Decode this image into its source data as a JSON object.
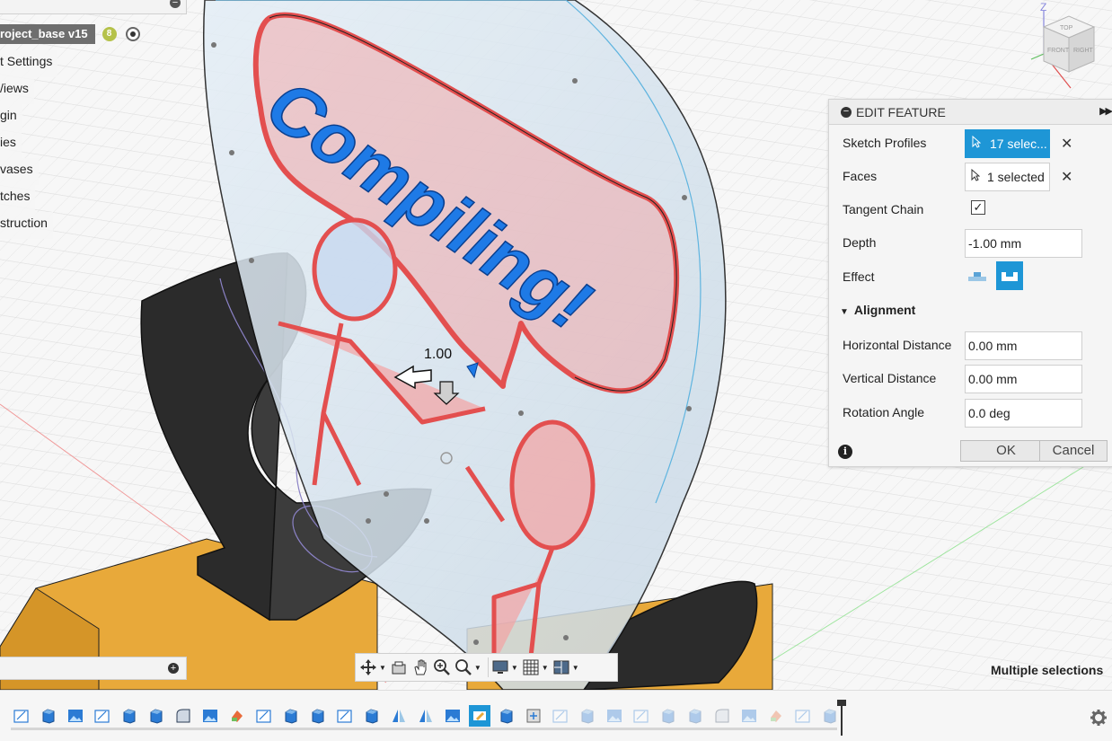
{
  "browser": {
    "document_title": "roject_base v15",
    "badge": "8",
    "items": [
      "t Settings",
      "/iews",
      "gin",
      "ies",
      "vases",
      "tches",
      "struction"
    ]
  },
  "viewport": {
    "sign_text": "Compiling!",
    "dimension_value": "1.00",
    "status": "Multiple selections"
  },
  "viewcube": {
    "axis_z": "Z",
    "face_top": "TOP",
    "face_front": "FRONT",
    "face_right": "RIGHT"
  },
  "edit_feature": {
    "title": "EDIT FEATURE",
    "sketch_profiles_label": "Sketch Profiles",
    "sketch_profiles_value": "17 selec...",
    "faces_label": "Faces",
    "faces_value": "1 selected",
    "tangent_chain_label": "Tangent Chain",
    "tangent_chain_checked": true,
    "depth_label": "Depth",
    "depth_value": "-1.00 mm",
    "effect_label": "Effect",
    "alignment_label": "Alignment",
    "horizontal_distance_label": "Horizontal Distance",
    "horizontal_distance_value": "0.00 mm",
    "vertical_distance_label": "Vertical Distance",
    "vertical_distance_value": "0.00 mm",
    "rotation_angle_label": "Rotation Angle",
    "rotation_angle_value": "0.0 deg",
    "ok_label": "OK",
    "cancel_label": "Cancel"
  },
  "navbar": {
    "tools": [
      "orbit-icon",
      "look-at-icon",
      "pan-icon",
      "zoom-icon",
      "zoom-window-icon",
      "display-settings-icon",
      "grid-settings-icon",
      "viewports-icon"
    ]
  },
  "timeline": {
    "item_count": 31,
    "selected_index": 17,
    "colors": {
      "accent": "#1e96d6",
      "body_black": "#2b2b2b",
      "base_orange": "#e8a93a",
      "profile_red": "#ef6f6f",
      "text_blue": "#1e7ae6"
    }
  }
}
